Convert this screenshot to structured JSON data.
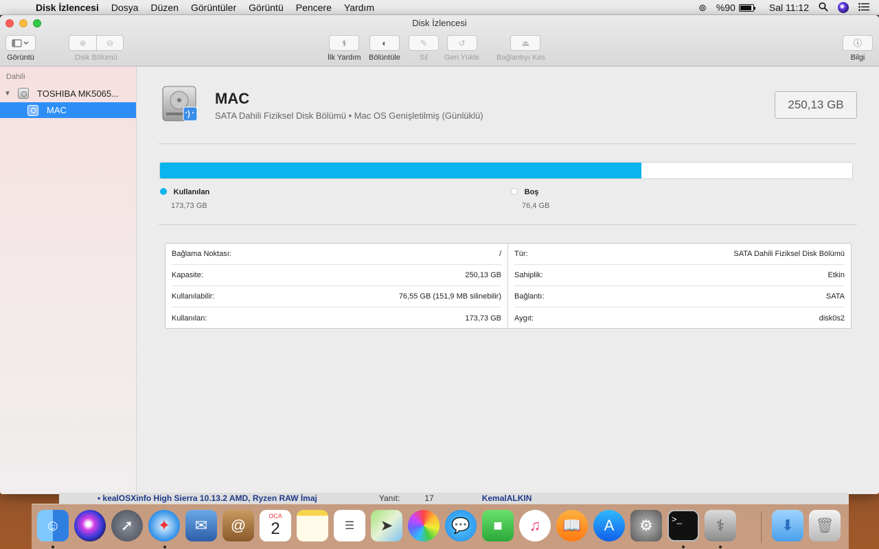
{
  "menubar": {
    "app_name": "Disk İzlencesi",
    "menus": [
      "Dosya",
      "Düzen",
      "Görüntüler",
      "Görüntü",
      "Pencere",
      "Yardım"
    ],
    "battery": "%90",
    "clock": "Sal 11:12"
  },
  "window": {
    "title": "Disk İzlencesi",
    "toolbar": {
      "view": "Görüntü",
      "partition": "Disk Bölümü",
      "first_aid": "İlk Yardım",
      "divide": "Bölüntüle",
      "erase": "Sil",
      "restore": "Geri Yükle",
      "unmount": "Bağlantıyı Kes",
      "info": "Bilgi"
    }
  },
  "sidebar": {
    "section": "Dahili",
    "disk": "TOSHIBA MK5065...",
    "volume": "MAC"
  },
  "main": {
    "title": "MAC",
    "subtitle": "SATA Dahili Fiziksel Disk Bölümü • Mac OS Genişletilmiş (Günlüklü)",
    "size": "250,13 GB",
    "used_fraction": 0.695,
    "legend": {
      "used_label": "Kullanılan",
      "used_value": "173,73 GB",
      "free_label": "Boş",
      "free_value": "76,4 GB"
    },
    "colors": {
      "used": "#0ab4ee",
      "free": "#ffffff"
    },
    "info_left": [
      {
        "label": "Bağlama Noktası:",
        "value": "/"
      },
      {
        "label": "Kapasite:",
        "value": "250,13 GB"
      },
      {
        "label": "Kullanılabilir:",
        "value": "76,55 GB (151,9 MB silinebilir)"
      },
      {
        "label": "Kullanılan:",
        "value": "173,73 GB"
      }
    ],
    "info_right": [
      {
        "label": "Tür:",
        "value": "SATA Dahili Fiziksel Disk Bölümü"
      },
      {
        "label": "Sahiplik:",
        "value": "Etkin"
      },
      {
        "label": "Bağlantı:",
        "value": "SATA"
      },
      {
        "label": "Aygıt:",
        "value": "disk0s2"
      }
    ]
  },
  "background": {
    "post_title": "• kealOSXinfo High Sierra 10.13.2 AMD, Ryzen RAW İmaj",
    "replies_label": "Yanıt:",
    "replies": "17",
    "author": "KemalALKIN"
  },
  "dock": {
    "calendar_month": "OCA",
    "calendar_day": "2",
    "apps": [
      "finder",
      "siri",
      "launchpad",
      "safari",
      "mail",
      "contacts",
      "calendar",
      "notes",
      "reminders",
      "maps",
      "photos",
      "messages",
      "facetime",
      "itunes",
      "ibooks",
      "app-store",
      "system-preferences",
      "terminal",
      "disk-utility",
      "downloads",
      "trash"
    ]
  }
}
